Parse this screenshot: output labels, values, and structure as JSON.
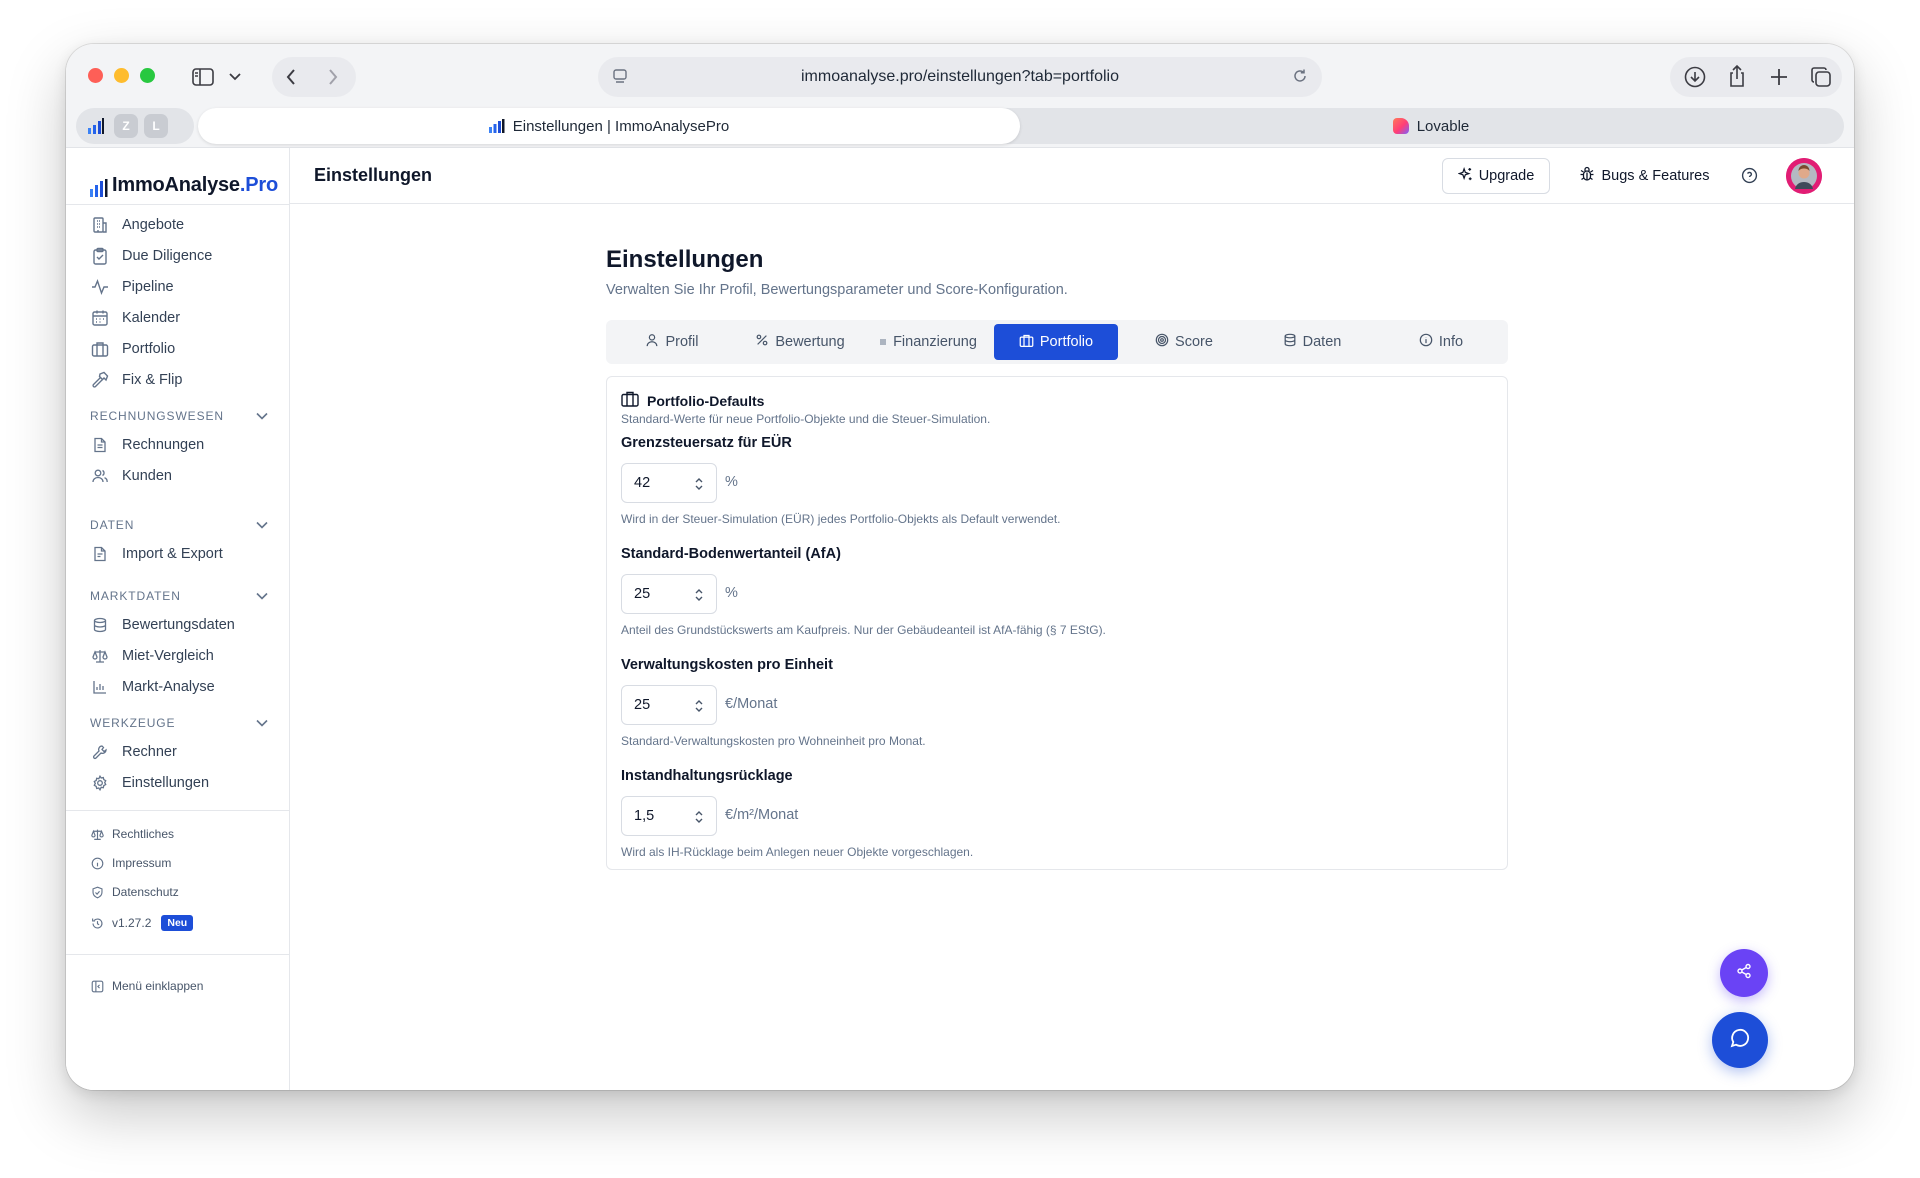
{
  "browser": {
    "url": "immoanalyse.pro/einstellungen?tab=portfolio",
    "pinned_tabs": [
      "Z",
      "L"
    ],
    "active_tab_title": "Einstellungen | ImmoAnalysePro",
    "other_tab_title": "Lovable"
  },
  "brand": {
    "name_main": "ImmoAnalyse",
    "name_dot": ".",
    "name_pro": "Pro"
  },
  "sidebar": {
    "main_items": [
      {
        "label": "Angebote",
        "icon": "building-icon"
      },
      {
        "label": "Due Diligence",
        "icon": "clipboard-check-icon"
      },
      {
        "label": "Pipeline",
        "icon": "activity-icon"
      },
      {
        "label": "Kalender",
        "icon": "calendar-icon"
      },
      {
        "label": "Portfolio",
        "icon": "briefcase-icon"
      },
      {
        "label": "Fix & Flip",
        "icon": "hammer-icon"
      }
    ],
    "sections": [
      {
        "title": "RECHNUNGSWESEN",
        "items": [
          {
            "label": "Rechnungen"
          },
          {
            "label": "Kunden"
          }
        ]
      },
      {
        "title": "DATEN",
        "items": [
          {
            "label": "Import & Export"
          }
        ]
      },
      {
        "title": "MARKTDATEN",
        "items": [
          {
            "label": "Bewertungsdaten"
          },
          {
            "label": "Miet-Vergleich"
          },
          {
            "label": "Markt-Analyse"
          }
        ]
      },
      {
        "title": "WERKZEUGE",
        "items": [
          {
            "label": "Rechner"
          },
          {
            "label": "Einstellungen"
          }
        ]
      }
    ],
    "footer_links": [
      "Rechtliches",
      "Impressum",
      "Datenschutz"
    ],
    "version": "v1.27.2",
    "version_badge": "Neu",
    "collapse_label": "Menü einklappen"
  },
  "header": {
    "title": "Einstellungen",
    "upgrade_label": "Upgrade",
    "bugs_label": "Bugs & Features"
  },
  "page": {
    "title": "Einstellungen",
    "subtitle": "Verwalten Sie Ihr Profil, Bewertungsparameter und Score-Konfiguration.",
    "tabs": [
      {
        "label": "Profil",
        "active": false
      },
      {
        "label": "Bewertung",
        "active": false
      },
      {
        "label": "Finanzierung",
        "active": false
      },
      {
        "label": "Portfolio",
        "active": true
      },
      {
        "label": "Score",
        "active": false
      },
      {
        "label": "Daten",
        "active": false
      },
      {
        "label": "Info",
        "active": false
      }
    ]
  },
  "card": {
    "title": "Portfolio-Defaults",
    "description": "Standard-Werte für neue Portfolio-Objekte und die Steuer-Simulation.",
    "fields": [
      {
        "label": "Grenzsteuersatz für EÜR",
        "value": "42",
        "unit": "%",
        "hint": "Wird in der Steuer-Simulation (EÜR) jedes Portfolio-Objekts als Default verwendet."
      },
      {
        "label": "Standard-Bodenwertanteil (AfA)",
        "value": "25",
        "unit": "%",
        "hint": "Anteil des Grundstückswerts am Kaufpreis. Nur der Gebäudeanteil ist AfA-fähig (§ 7 EStG)."
      },
      {
        "label": "Verwaltungskosten pro Einheit",
        "value": "25",
        "unit": "€/Monat",
        "hint": "Standard-Verwaltungskosten pro Wohneinheit pro Monat."
      },
      {
        "label": "Instandhaltungsrücklage",
        "value": "1,5",
        "unit": "€/m²/Monat",
        "hint": "Wird als IH-Rücklage beim Anlegen neuer Objekte vorgeschlagen."
      }
    ]
  },
  "colors": {
    "accent": "#1d4ed8",
    "share_fab": "#6a43f5",
    "avatar": "#e11d74"
  }
}
